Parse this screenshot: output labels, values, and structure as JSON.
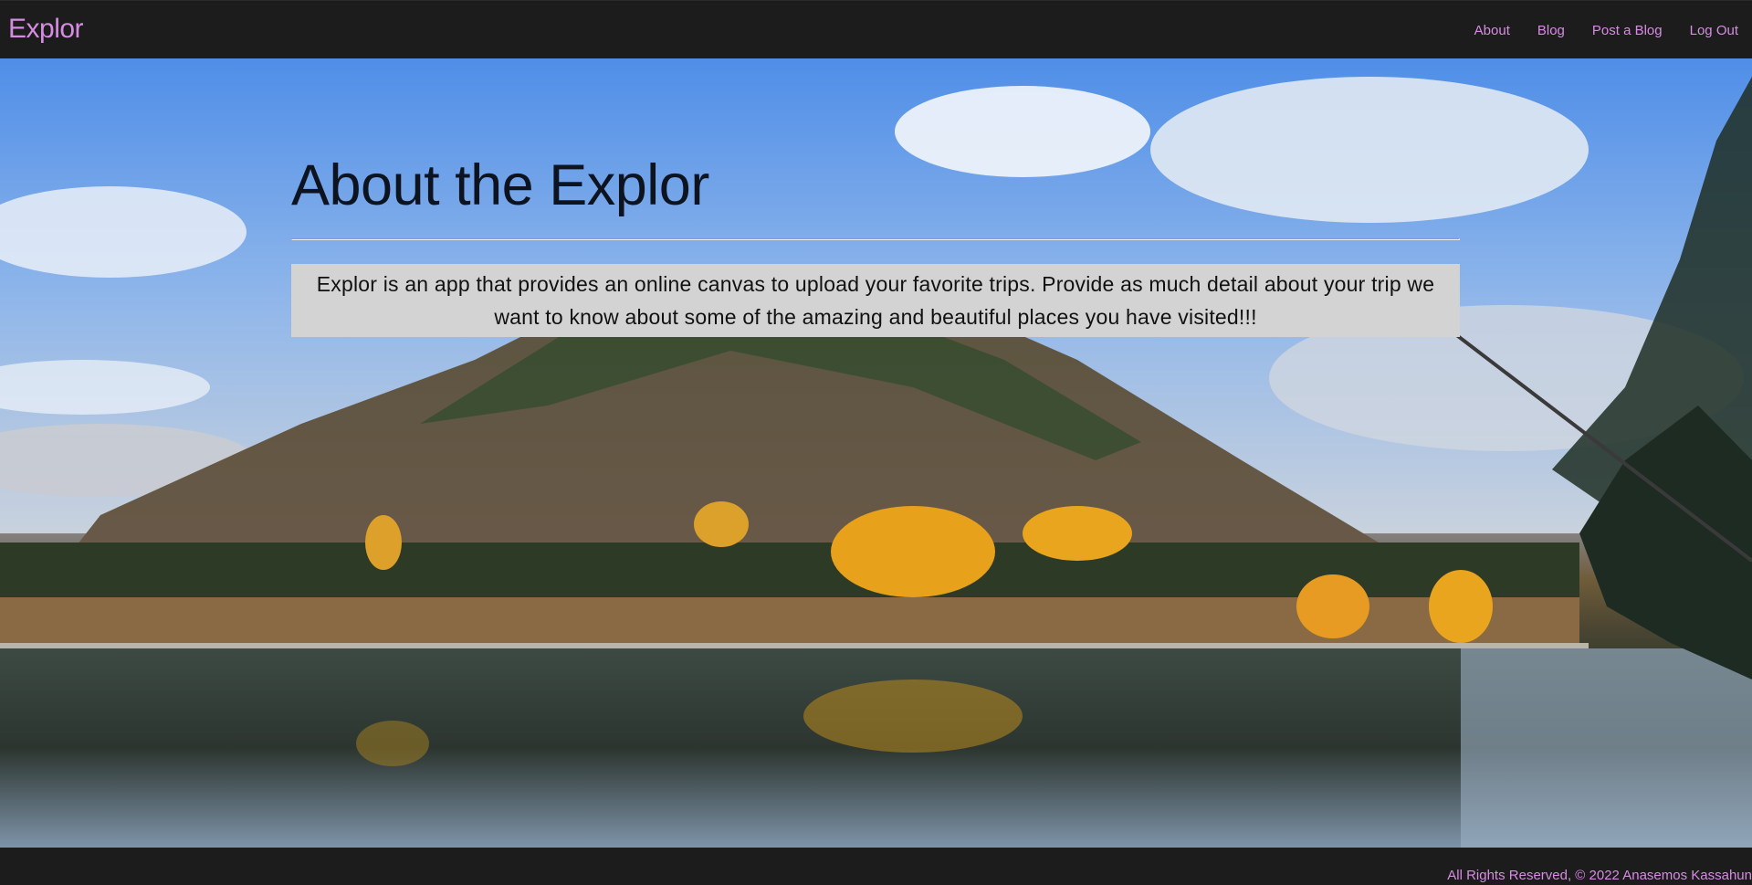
{
  "nav": {
    "brand": "Explor",
    "links": [
      "About",
      "Blog",
      "Post a Blog",
      "Log Out"
    ]
  },
  "main": {
    "title": "About the Explor",
    "description": "Explor is an app that provides an online canvas to upload your favorite trips. Provide as much detail about your trip we want to know about some of the amazing and beautiful places you have visited!!!"
  },
  "footer": {
    "text": "All Rights Reserved, © 2022 Anasemos Kassahun"
  },
  "colors": {
    "navbar": "#1c1c1c",
    "accent": "#d78ce3",
    "title": "#0d1420",
    "desc_bg": "#d3d3d3"
  }
}
